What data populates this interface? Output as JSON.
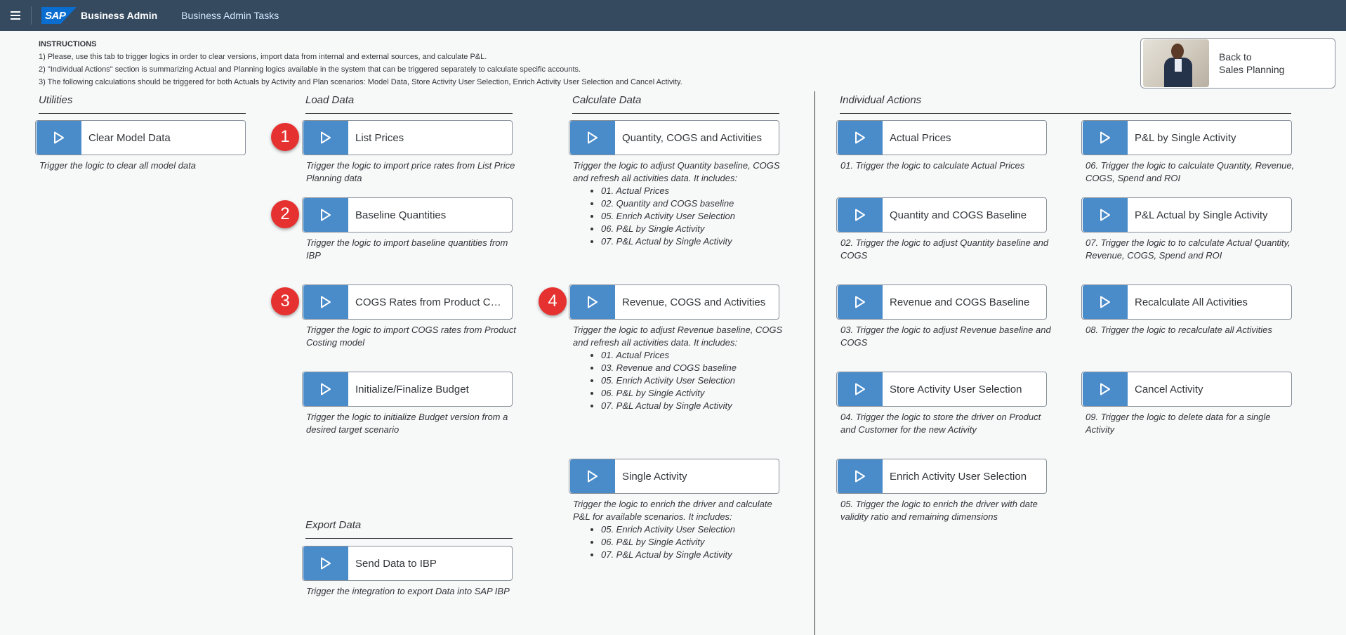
{
  "shell": {
    "logo": "SAP",
    "title": "Business Admin",
    "link": "Business Admin Tasks"
  },
  "instructions": {
    "heading": "INSTRUCTIONS",
    "lines": [
      "1) Please, use this tab to trigger logics in order to clear versions, import data from internal and external sources, and calculate P&L.",
      "2) \"Individual Actions\" section is summarizing Actual and Planning logics available in the system that can be triggered separately to calculate specific accounts.",
      "3) The following calculations should be triggered for both Actuals by Activity and Plan scenarios: Model Data, Store Activity User Selection, Enrich Activity User Selection and Cancel Activity."
    ]
  },
  "back": {
    "line1": "Back to",
    "line2": "Sales Planning"
  },
  "sections": {
    "utilities": "Utilities",
    "load_data": "Load Data",
    "calculate_data": "Calculate Data",
    "individual_actions": "Individual Actions",
    "export_data": "Export Data"
  },
  "badges": [
    "1",
    "2",
    "3",
    "4"
  ],
  "tiles": {
    "clear_model": {
      "label": "Clear Model Data",
      "desc": "Trigger the logic to clear all model data"
    },
    "list_prices": {
      "label": "List Prices",
      "desc": "Trigger the logic to import price rates from List Price Planning data"
    },
    "baseline_quantities": {
      "label": "Baseline Quantities",
      "desc": "Trigger the logic to import baseline quantities from IBP"
    },
    "cogs_rates": {
      "label": "COGS Rates from Product Costing",
      "desc": "Trigger the logic to import COGS rates from Product Costing model"
    },
    "init_budget": {
      "label": "Initialize/Finalize Budget",
      "desc": "Trigger the logic to initialize Budget version from a desired target scenario"
    },
    "send_ibp": {
      "label": "Send Data to IBP",
      "desc": "Trigger the integration to export Data into SAP IBP"
    },
    "qty_cogs_act": {
      "label": "Quantity, COGS and Activities",
      "desc": "Trigger the logic to adjust Quantity baseline, COGS and refresh all activities data. It includes:",
      "items": [
        "01. Actual Prices",
        "02. Quantity and COGS baseline",
        "05. Enrich Activity User Selection",
        "06. P&L by Single Activity",
        "07. P&L Actual by Single Activity"
      ]
    },
    "rev_cogs_act": {
      "label": "Revenue, COGS and Activities",
      "desc": "Trigger the logic to adjust Revenue baseline, COGS and refresh all activities data. It includes:",
      "items": [
        "01. Actual Prices",
        "03. Revenue and COGS baseline",
        "05. Enrich Activity User Selection",
        "06. P&L by Single Activity",
        "07. P&L Actual by Single Activity"
      ]
    },
    "single_activity": {
      "label": "Single Activity",
      "desc": "Trigger the logic to enrich the driver and calculate P&L for available scenarios. It includes:",
      "items": [
        "05. Enrich Activity User Selection",
        "06. P&L by Single Activity",
        "07. P&L Actual by Single Activity"
      ]
    },
    "actual_prices": {
      "label": "Actual Prices",
      "desc": "01. Trigger the logic to calculate Actual Prices"
    },
    "qty_cogs_baseline": {
      "label": "Quantity and COGS Baseline",
      "desc": "02. Trigger the logic to adjust Quantity baseline and COGS"
    },
    "rev_cogs_baseline": {
      "label": "Revenue and COGS Baseline",
      "desc": "03. Trigger the logic to adjust Revenue baseline and COGS"
    },
    "store_activity": {
      "label": "Store Activity User Selection",
      "desc": "04. Trigger the logic to store the driver on Product and Customer for the new Activity"
    },
    "enrich_activity": {
      "label": "Enrich Activity User Selection",
      "desc": "05. Trigger the logic to enrich the driver with date validity ratio and remaining dimensions"
    },
    "pl_single": {
      "label": "P&L by Single Activity",
      "desc": "06. Trigger the logic to calculate Quantity, Revenue, COGS, Spend and ROI"
    },
    "pl_actual_single": {
      "label": "P&L Actual by Single Activity",
      "desc": "07. Trigger the logic to to calculate Actual Quantity, Revenue, COGS, Spend and ROI"
    },
    "recalc_all": {
      "label": "Recalculate All Activities",
      "desc": "08. Trigger the logic to recalculate all Activities"
    },
    "cancel_activity": {
      "label": "Cancel Activity",
      "desc": "09. Trigger the logic to delete data for a single Activity"
    }
  },
  "colors": {
    "shell": "#354a5f",
    "accent": "#4a8cca",
    "badge": "#e5312f"
  },
  "icons": {
    "tile": "play-icon",
    "menu": "hamburger-menu-icon"
  }
}
